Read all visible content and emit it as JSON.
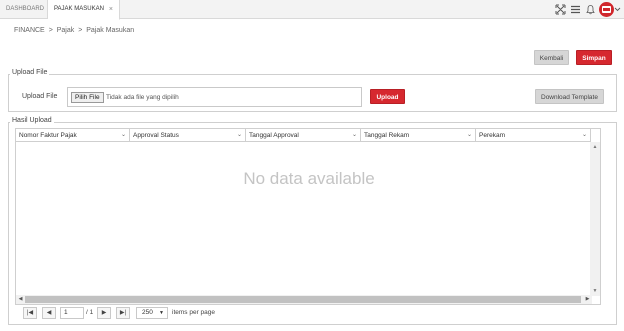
{
  "tabs": [
    {
      "label": "DASHBOARD"
    },
    {
      "label": "PAJAK MASUKAN",
      "close": "×"
    }
  ],
  "topicons": [
    "expand-icon",
    "menu-icon",
    "bell-icon",
    "avatar",
    "chevron-down-icon"
  ],
  "breadcrumb": [
    "FINANCE",
    ">",
    "Pajak",
    ">",
    "Pajak Masukan"
  ],
  "actions": {
    "kembali": "Kembali",
    "simpan": "Simpan"
  },
  "upload_section": {
    "legend": "Upload File",
    "label": "Upload File",
    "file_button": "Pilih File",
    "file_status": "Tidak ada file yang dipilih",
    "upload_button": "Upload",
    "download_button": "Download Template"
  },
  "result_section": {
    "legend": "Hasil Upload",
    "columns": [
      "Nomor Faktur Pajak",
      "Approval Status",
      "Tanggal Approval",
      "Tanggal Rekam",
      "Perekam"
    ],
    "empty_text": "No data available"
  },
  "pager": {
    "page": "1",
    "of_text": "/ 1",
    "page_size": "250",
    "items_per_page": "items per page"
  },
  "colors": {
    "accent": "#d6282f",
    "border": "#cfcfcf"
  }
}
